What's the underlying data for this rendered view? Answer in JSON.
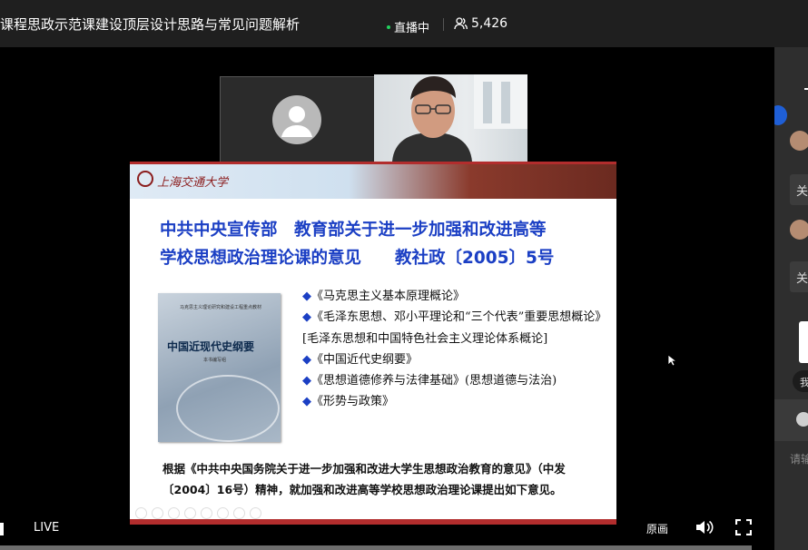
{
  "header": {
    "title": "课程思政示范课建设顶层设计思路与常见问题解析",
    "live_status": "直播中",
    "viewer_count": "5,426",
    "live_dot_color": "#22d15e"
  },
  "slide": {
    "logo_text": "上海交通大学",
    "heading_line1": "中共中央宣传部　教育部关于进一步加强和改进高等",
    "heading_line2": "学校思想政治理论课的意见　　教社政〔2005〕5号",
    "book": {
      "small_text": "马克思主义理论研究和建设工程重点教材",
      "title": "中国近现代史纲要",
      "subtitle": "本书编写组"
    },
    "items": [
      "《马克思主义基本原理概论》",
      "《毛泽东思想、邓小平理论和“三个代表”重要思想概论》[毛泽东思想和中国特色社会主义理论体系概论]",
      "《中国近代史纲要》",
      "《思想道德修养与法律基础》(思想道德与法治)",
      "《形势与政策》"
    ],
    "bullet": "◆",
    "footnote": "根据《中共中央国务院关于进一步加强和改进大学生思想政治教育的意见》（中发〔2004〕16号）精神，就加强和改进高等学校思想政治理论课提出如下意见。",
    "heading_color": "#1b3fc4"
  },
  "controls": {
    "live_label": "LIVE",
    "quality_label": "原画"
  },
  "side": {
    "chip1": "关",
    "chip2": "关",
    "pill": "我",
    "input_placeholder": "请输"
  },
  "icons": {
    "viewers": "people-icon",
    "volume": "volume-icon",
    "fullscreen": "fullscreen-icon",
    "emoji": "emoji-icon",
    "avatar": "user-avatar-icon",
    "cursor": "mouse-cursor-icon"
  }
}
